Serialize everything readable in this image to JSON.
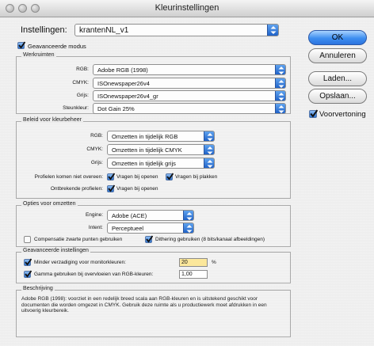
{
  "window": {
    "title": "Kleurinstellingen"
  },
  "settings": {
    "label": "Instellingen:",
    "value": "krantenNL_v1"
  },
  "advanced": {
    "label": "Geavanceerde modus",
    "checked": true
  },
  "workspaces": {
    "title": "Werkruimten",
    "rows": [
      {
        "label": "RGB:",
        "value": "Adobe RGB (1998)"
      },
      {
        "label": "CMYK:",
        "value": "ISOnewspaper26v4"
      },
      {
        "label": "Grijs:",
        "value": "ISOnewspaper26v4_gr"
      },
      {
        "label": "Steunkleur:",
        "value": "Dot Gain 25%"
      }
    ]
  },
  "policies": {
    "title": "Beleid voor kleurbeheer",
    "rows": [
      {
        "label": "RGB:",
        "value": "Omzetten in tijdelijk RGB"
      },
      {
        "label": "CMYK:",
        "value": "Omzetten in tijdelijk CMYK"
      },
      {
        "label": "Grijs:",
        "value": "Omzetten in tijdelijk grijs"
      }
    ],
    "mismatch_label": "Profielen komen niet overeen:",
    "mismatch_open": "Vragen bij openen",
    "mismatch_paste": "Vragen bij plakken",
    "missing_label": "Ontbrekende profielen:",
    "missing_open": "Vragen bij openen"
  },
  "conversion": {
    "title": "Opties voor omzetten",
    "engine_label": "Engine:",
    "engine_value": "Adobe (ACE)",
    "intent_label": "Intent:",
    "intent_value": "Perceptueel",
    "bpc_label": "Compensatie zwarte punten gebruiken",
    "bpc_checked": false,
    "dither_label": "Dithering gebruiken (8 bits/kanaal afbeeldingen)",
    "dither_checked": true
  },
  "advanced_controls": {
    "title": "Geavanceerde instellingen",
    "desaturate_label": "Minder verzadiging voor monitorkleuren:",
    "desaturate_value": "20",
    "desaturate_unit": "%",
    "gamma_label": "Gamma gebruiken bij overvloeien van RGB-kleuren:",
    "gamma_value": "1,00"
  },
  "description": {
    "title": "Beschrijving",
    "text": "Adobe RGB (1998): voorziet in een redelijk breed scala aan RGB-kleuren en is uitstekend geschikt voor documenten die worden omgezet in CMYK. Gebruik deze ruimte als u productiewerk moet afdrukken in een uitvoerig kleurbereik."
  },
  "buttons": {
    "ok": "OK",
    "cancel": "Annuleren",
    "load": "Laden...",
    "save": "Opslaan...",
    "preview_label": "Voorvertoning",
    "preview_checked": true
  },
  "colors": {
    "accent": "#2c74de",
    "highlight": "#fbe79b"
  }
}
